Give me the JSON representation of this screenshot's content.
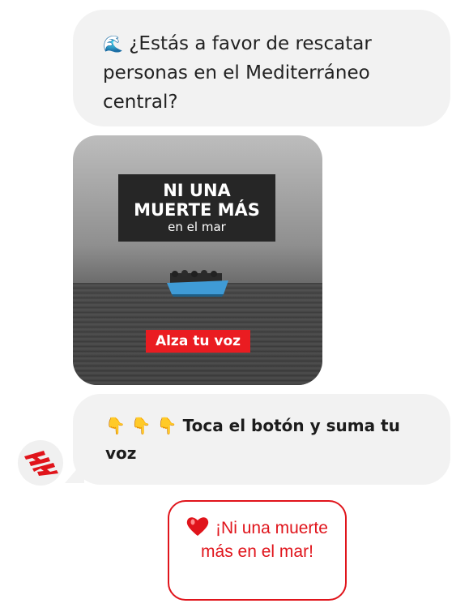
{
  "message1": {
    "emoji": "🌊",
    "text": "¿Estás a favor de rescatar personas en el Mediterráneo central?"
  },
  "media_card": {
    "headline_line1": "NI UNA",
    "headline_line2": "MUERTE MÁS",
    "headline_line3": "en el mar",
    "cta_label": "Alza tu voz"
  },
  "message2": {
    "emojis": "👇 👇 👇",
    "text": "Toca el botón y suma tu voz"
  },
  "quick_reply": {
    "emoji": "❤️",
    "label": "¡Ni una muerte más en el mar!"
  },
  "colors": {
    "accent_red": "#e0141b",
    "bubble_gray": "#f2f2f2"
  }
}
